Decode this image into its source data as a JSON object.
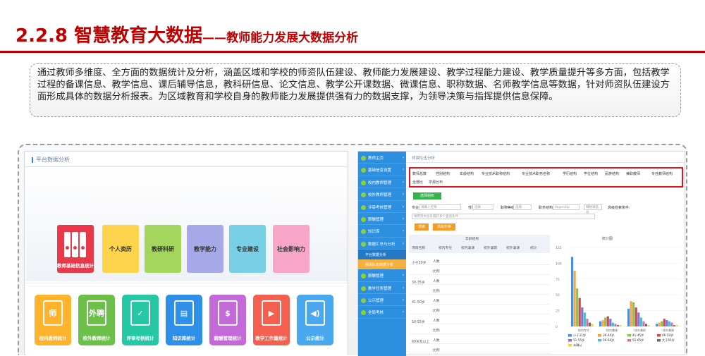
{
  "header": {
    "title_main": "2.2.8 智慧教育大数据",
    "title_sub": "——教师能力发展大数据分析"
  },
  "description": "通过教师多维度、全方面的数据统计及分析，涵盖区域和学校的师资队伍建设、教师能力发展建设、教学过程能力建设、教学质量提升等多方面，包括教学过程的备课信息、教学信息、课后辅导信息，教科研信息、论文信息、教学公开课数据、微课信息、职称数据、名师教学信息等数据，针对师资队伍建设方面形成具体的数据分析报表。为区域教育和学校自身的教师能力发展提供强有力的数据支撑，为领导决策与指挥提供信息保障。",
  "left_panel": {
    "header": "平台数据分析",
    "top_tiles": [
      {
        "label": "教师基础信息统计",
        "color": "#e8394b"
      },
      {
        "label": "个人资历",
        "color": "#ffd44d"
      },
      {
        "label": "教研科研",
        "color": "#a4d65e"
      },
      {
        "label": "教学能力",
        "color": "#a6a8e8"
      },
      {
        "label": "专业建设",
        "color": "#79cfe6"
      },
      {
        "label": "社会影响力",
        "color": "#f7a6c8"
      }
    ],
    "bottom_tiles": [
      {
        "label": "校内教师统计",
        "color": "#ffb22b",
        "glyph": "师"
      },
      {
        "label": "校外教师统计",
        "color": "#6cc04a",
        "glyph": "外聘"
      },
      {
        "label": "评审考核统计",
        "color": "#25c7a5",
        "glyph": "✓"
      },
      {
        "label": "知识库统计",
        "color": "#2e8fe8",
        "glyph": "▤"
      },
      {
        "label": "薪酬管理统计",
        "color": "#c46ad8",
        "glyph": "$"
      },
      {
        "label": "教学工作量统计",
        "color": "#f4604f",
        "glyph": "▶"
      },
      {
        "label": "公示统计",
        "color": "#4aa8ee",
        "glyph": "◀)"
      }
    ]
  },
  "right_panel": {
    "sidebar": [
      "教师主页",
      "基础信息设置",
      "校内教师管理",
      "校外教师管理",
      "评审考核管理",
      "薪酬管理",
      "知识库",
      "数据汇总与分析",
      "薪酬管理",
      "教学任务管理",
      "公示管理",
      "全局考核"
    ],
    "sidebar_sub": [
      "平台数据分析",
      "师资队伍数据分析"
    ],
    "breadcrumb": "师资队伍分析",
    "tabs_row1": [
      "数师总数",
      "性别结构",
      "年龄结构",
      "专业技术职称结构",
      "专业技术职务名称",
      "学历结构",
      "学位结构",
      "民族结构",
      "兼职教师",
      "专任教师结构"
    ],
    "tabs_row2": [
      "全部比",
      "学源分布"
    ],
    "select_btn": "选择组织",
    "filter_labels": [
      "专业:",
      "性别:",
      "职称等级:",
      "职务结构:",
      "高级检索条件:"
    ],
    "filter_values": [
      "请输入名称",
      "选择",
      "选择",
      "Pagenitip",
      "细致请选址",
      "请用英文逗号隔开多个查询条件"
    ],
    "search_btn": "搜索",
    "advanced_btn": "高级检索",
    "table_headers": [
      "项目名称",
      "校内专任",
      "校内兼课",
      "校外兼职",
      "校外兼课",
      "统计"
    ],
    "table_group": "年龄结构",
    "row_groups": [
      "小于30岁",
      "30-35岁",
      "41-50岁",
      "50-55岁",
      "60岁及以上"
    ],
    "row_kinds": [
      "人数",
      "比例"
    ],
    "chart_title": "统计图",
    "legend": [
      "小于31岁",
      "36-40岁",
      "41-45岁",
      "46-50岁",
      "51-55岁",
      "56-60岁",
      "55-65岁",
      "大于65岁",
      "未确认"
    ],
    "chart_axis": [
      "125",
      "100",
      "75",
      "50",
      "25",
      "0"
    ]
  },
  "chart_data": {
    "type": "bar",
    "title": "统计图",
    "categories": [
      "校内专任",
      "校内兼课",
      "校外兼职",
      "校外兼课"
    ],
    "series": [
      {
        "name": "小于31岁",
        "values": [
          110,
          8,
          28,
          4
        ]
      },
      {
        "name": "36-40岁",
        "values": [
          88,
          10,
          40,
          6
        ]
      },
      {
        "name": "41-45岁",
        "values": [
          60,
          14,
          38,
          8
        ]
      },
      {
        "name": "46-50岁",
        "values": [
          45,
          16,
          30,
          12
        ]
      },
      {
        "name": "51-55岁",
        "values": [
          30,
          12,
          22,
          10
        ]
      },
      {
        "name": "56-60岁",
        "values": [
          22,
          6,
          14,
          8
        ]
      },
      {
        "name": "55-65岁",
        "values": [
          12,
          4,
          8,
          6
        ]
      },
      {
        "name": "大于65岁",
        "values": [
          6,
          2,
          4,
          2
        ]
      },
      {
        "name": "未确认",
        "values": [
          4,
          2,
          2,
          2
        ]
      }
    ],
    "ylim": [
      0,
      125
    ],
    "colors": [
      "#4a90d9",
      "#f0a64a",
      "#88c64a",
      "#d04a4a",
      "#8a6ed0",
      "#4ac0c0",
      "#e06aa8",
      "#6a6a6a",
      "#e8d44a"
    ]
  }
}
